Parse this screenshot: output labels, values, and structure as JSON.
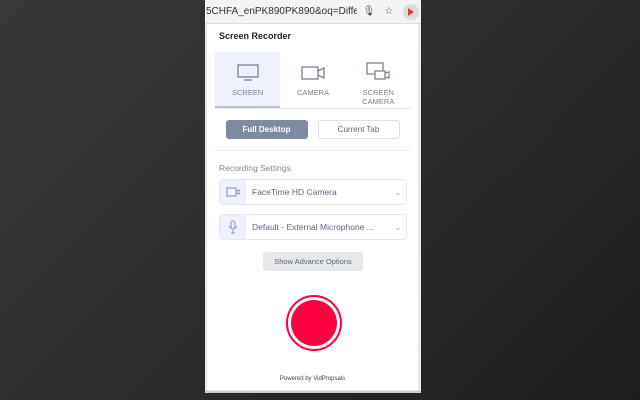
{
  "browser": {
    "url": "5CHFA_enPK890PK890&oq=Diffe..."
  },
  "popup": {
    "title": "Screen Recorder",
    "tabs": [
      {
        "label": "SCREEN"
      },
      {
        "label": "CAMERA"
      },
      {
        "label": "SCREEN CAMERA"
      }
    ],
    "modes": [
      "Full Desktop",
      "Current Tab"
    ],
    "recording_settings_label": "Recording Settings",
    "camera_select": "FaceTime HD Camera",
    "mic_select": "Default - External Microphone ...",
    "advance_button": "Show Advance Options",
    "powered_by": "Powered by VidPropsals"
  },
  "colors": {
    "record": "#ff0040",
    "accent": "#7d8aa0"
  }
}
